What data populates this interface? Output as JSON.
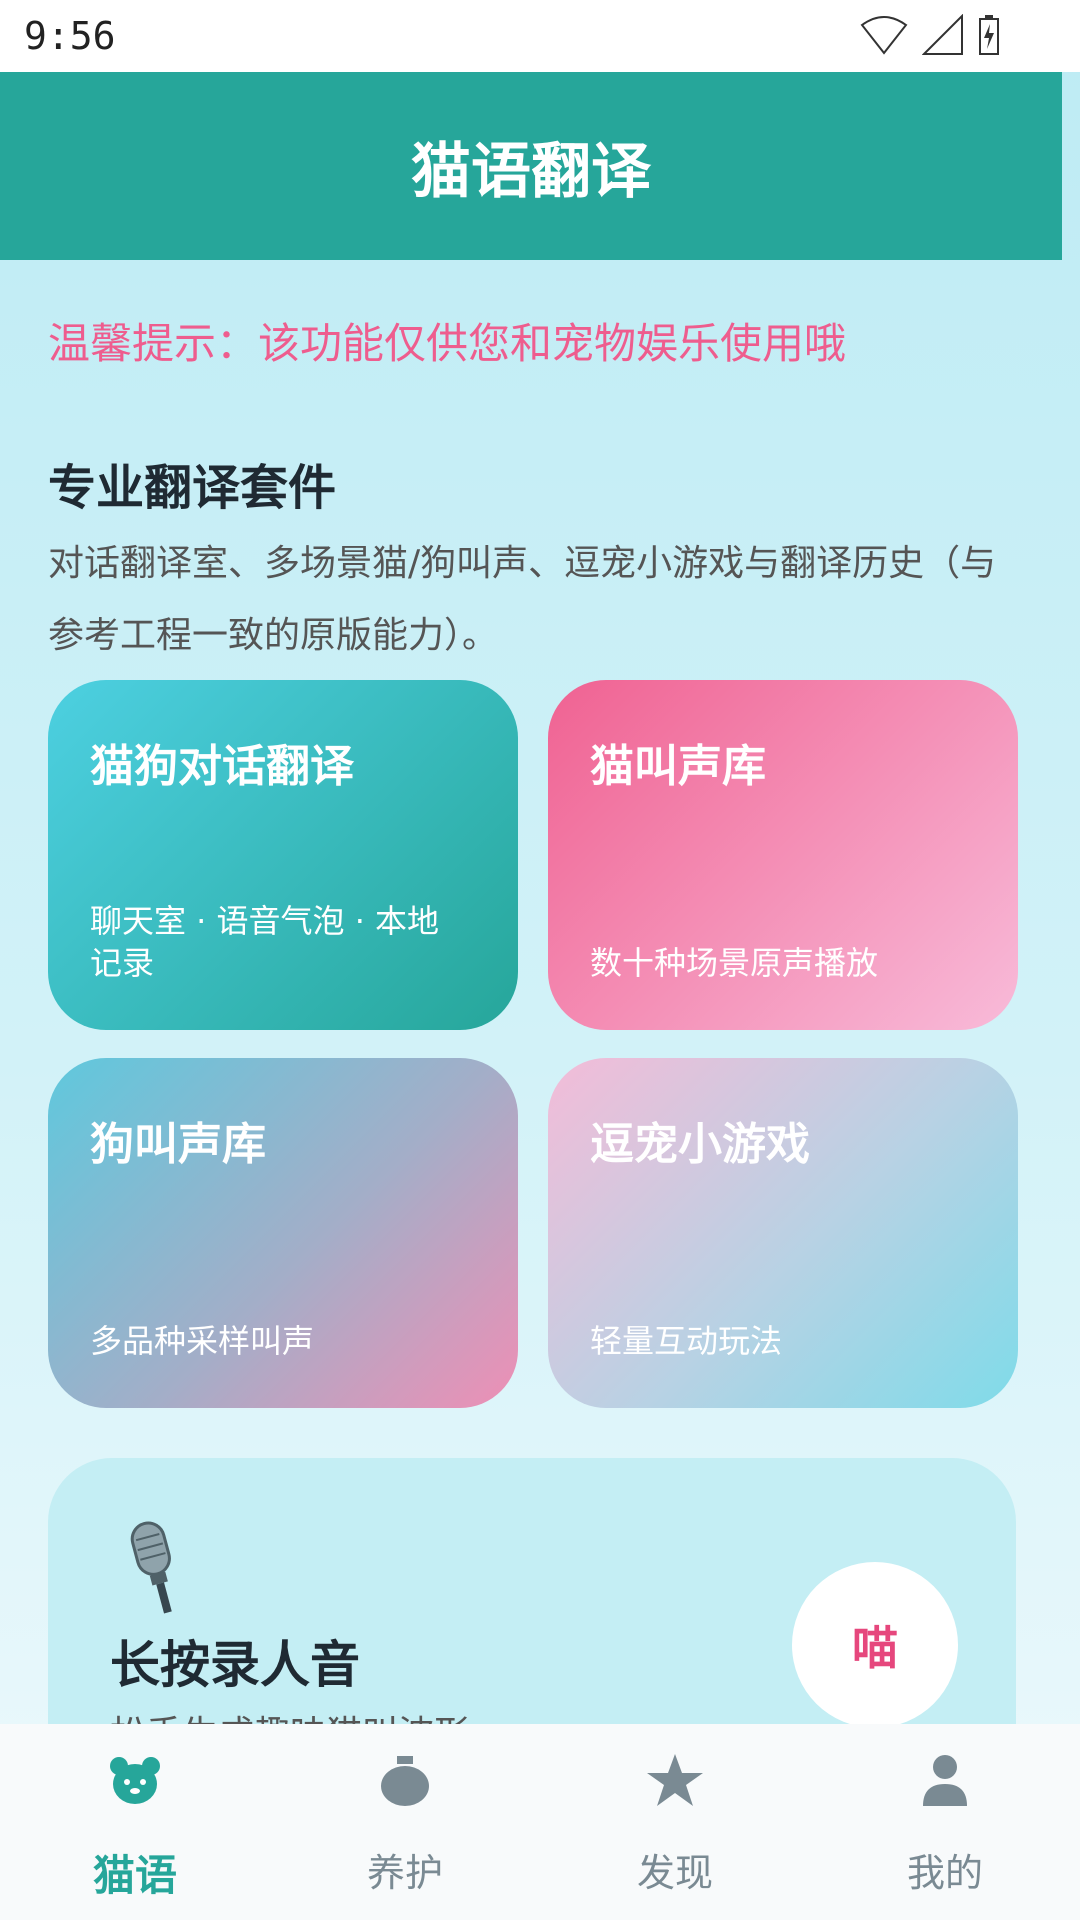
{
  "status": {
    "time": "9:56"
  },
  "header": {
    "title": "猫语翻译"
  },
  "tip": "温馨提示：该功能仅供您和宠物娱乐使用哦",
  "suite": {
    "title": "专业翻译套件",
    "description": "对话翻译室、多场景猫/狗叫声、逗宠小游戏与翻译历史（与参考工程一致的原版能力）。"
  },
  "cards": [
    {
      "title": "猫狗对话翻译",
      "subtitle": "聊天室 · 语音气泡 · 本地记录"
    },
    {
      "title": "猫叫声库",
      "subtitle": "数十种场景原声播放"
    },
    {
      "title": "狗叫声库",
      "subtitle": "多品种采样叫声"
    },
    {
      "title": "逗宠小游戏",
      "subtitle": "轻量互动玩法"
    }
  ],
  "record": {
    "title": "长按录人音",
    "subtitle": "松手生成趣味猫叫波形",
    "meow_button": "喵"
  },
  "nav": [
    {
      "label": "猫语",
      "icon": "cat-face-icon",
      "active": true
    },
    {
      "label": "养护",
      "icon": "food-bag-icon",
      "active": false
    },
    {
      "label": "发现",
      "icon": "star-icon",
      "active": false
    },
    {
      "label": "我的",
      "icon": "person-icon",
      "active": false
    }
  ],
  "colors": {
    "primary": "#26a69a",
    "tip": "#ee5d8e",
    "meow": "#e6477d"
  }
}
